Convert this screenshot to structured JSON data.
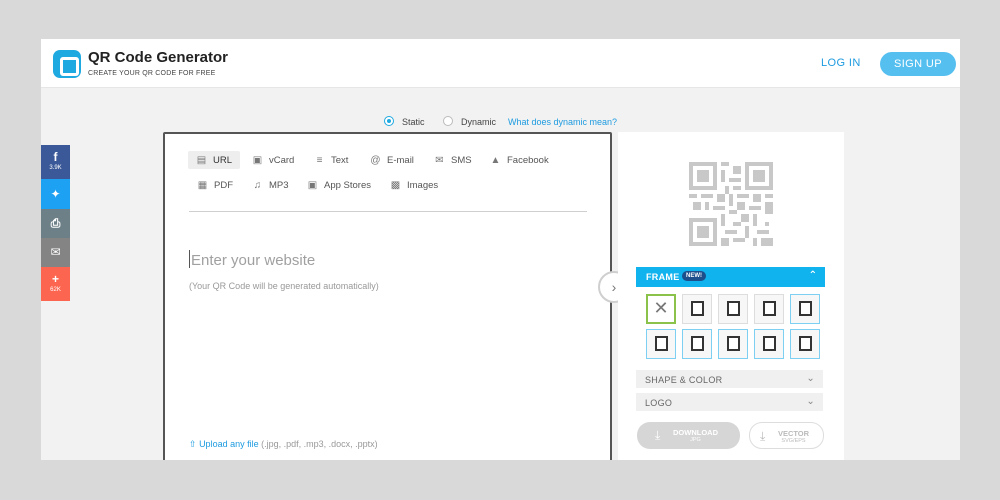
{
  "header": {
    "title": "QR Code Generator",
    "subtitle": "CREATE YOUR QR CODE FOR FREE",
    "login_label": "LOG IN",
    "signup_label": "SIGN UP"
  },
  "type_selector": {
    "options": [
      {
        "label": "Static",
        "selected": true
      },
      {
        "label": "Dynamic",
        "selected": false
      }
    ],
    "help_link": "What does dynamic mean?"
  },
  "tabs": [
    {
      "label": "URL",
      "icon": "url-icon",
      "active": true
    },
    {
      "label": "vCard",
      "icon": "vcard-icon",
      "active": false
    },
    {
      "label": "Text",
      "icon": "text-icon",
      "active": false
    },
    {
      "label": "E-mail",
      "icon": "email-icon",
      "active": false
    },
    {
      "label": "SMS",
      "icon": "sms-icon",
      "active": false
    },
    {
      "label": "Facebook",
      "icon": "facebook-icon",
      "active": false
    },
    {
      "label": "PDF",
      "icon": "pdf-icon",
      "active": false
    },
    {
      "label": "MP3",
      "icon": "mp3-icon",
      "active": false
    },
    {
      "label": "App Stores",
      "icon": "app-stores-icon",
      "active": false
    },
    {
      "label": "Images",
      "icon": "images-icon",
      "active": false
    }
  ],
  "url_form": {
    "placeholder": "Enter your website",
    "value": "",
    "hint": "(Your QR Code will be generated automatically)",
    "upload_link": "Upload any file",
    "upload_types": " (.jpg, .pdf, .mp3, .docx, .pptx)"
  },
  "customize": {
    "frame_title": "FRAME",
    "new_badge": "NEW!",
    "shape_color_title": "SHAPE & COLOR",
    "logo_title": "LOGO"
  },
  "download": {
    "primary_label": "DOWNLOAD",
    "primary_format": "JPG",
    "secondary_label": "VECTOR",
    "secondary_format": "SVG/EPS"
  },
  "share_bar": [
    {
      "icon": "facebook-icon",
      "count": "3.9K",
      "color": "#3b5998"
    },
    {
      "icon": "twitter-icon",
      "count": "",
      "color": "#1da1f2"
    },
    {
      "icon": "print-icon",
      "count": "",
      "color": "#6d7f87"
    },
    {
      "icon": "mail-icon",
      "count": "",
      "color": "#848484"
    },
    {
      "icon": "plus-icon",
      "count": "62K",
      "color": "#fc6650"
    }
  ],
  "colors": {
    "brand": "#1fa9e1",
    "accent": "#55bff0",
    "frame_header": "#10b3ee"
  }
}
